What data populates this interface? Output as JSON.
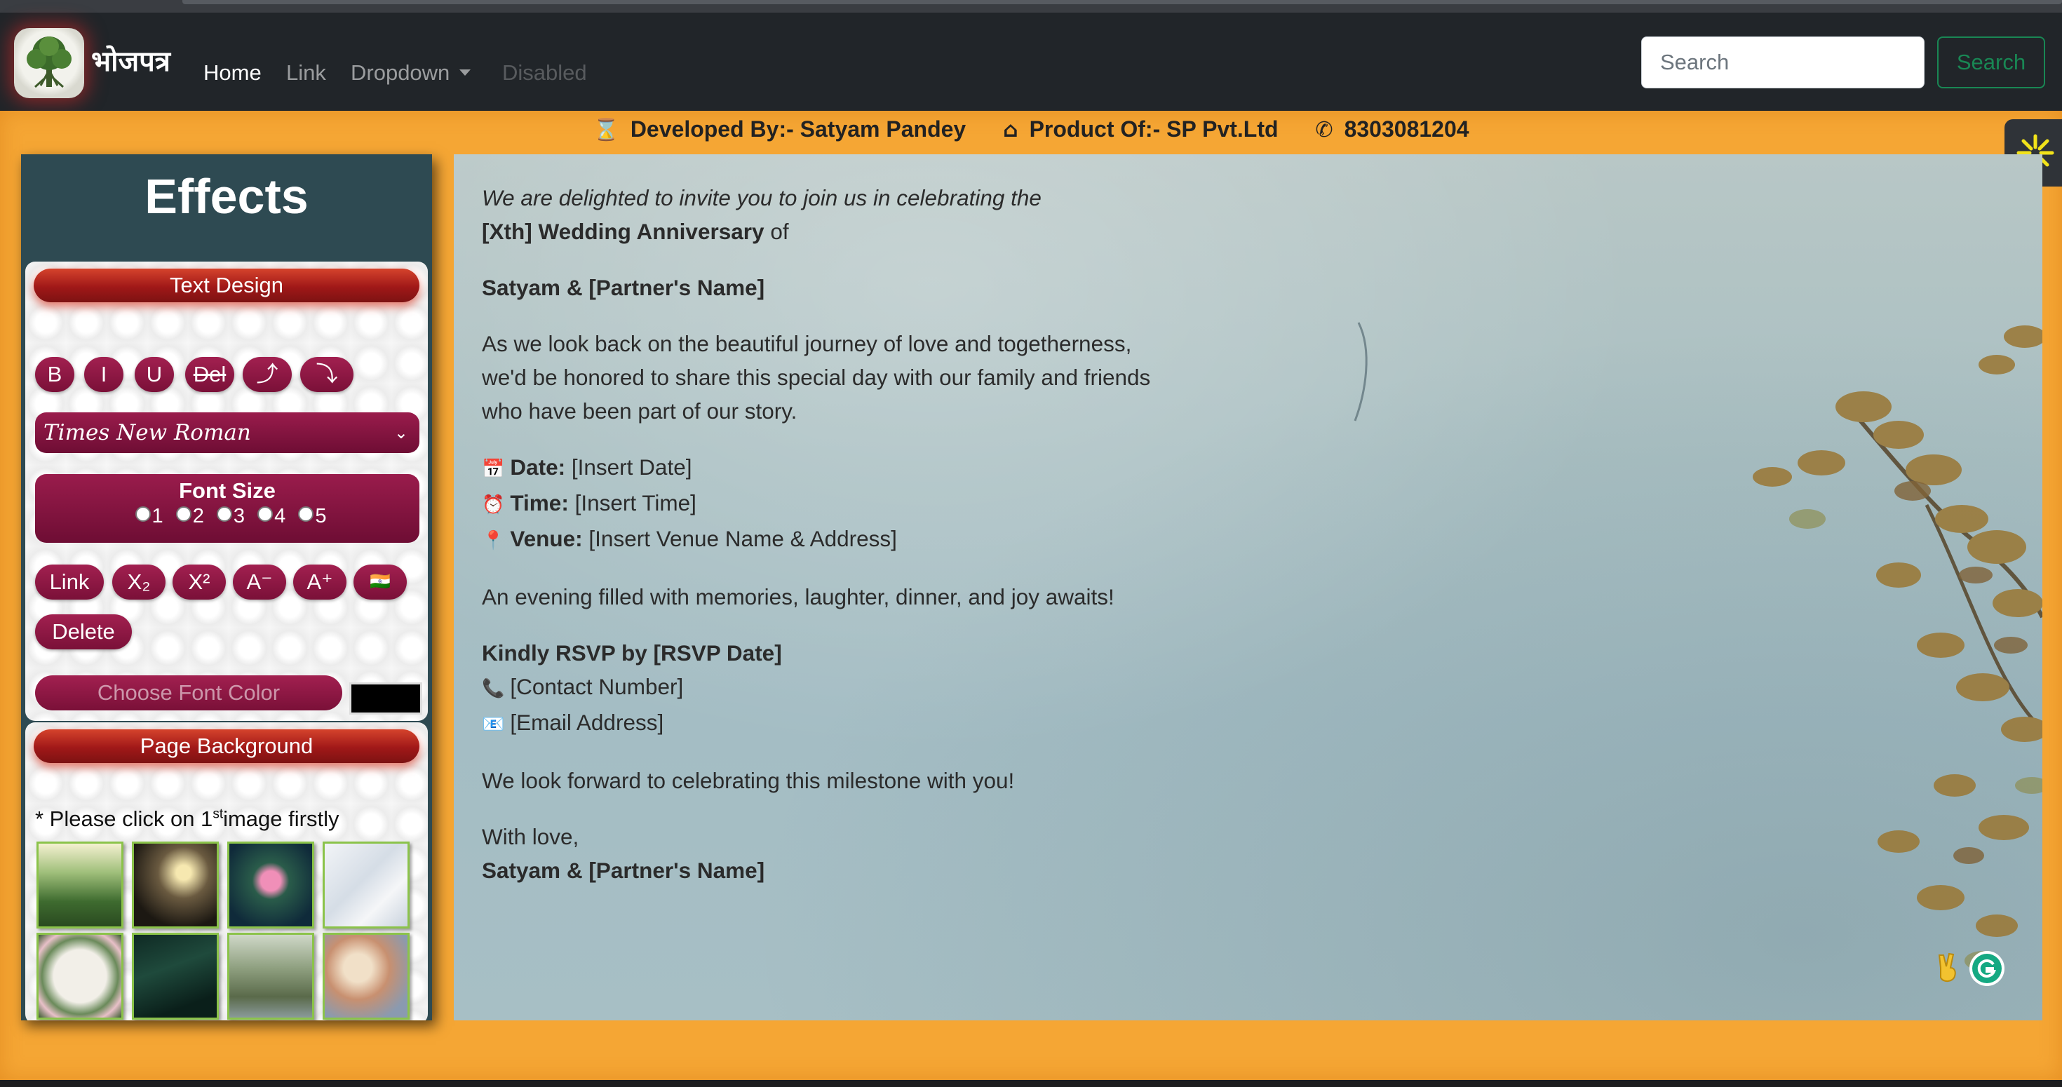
{
  "navbar": {
    "brand": "भोजपत्र",
    "links": [
      {
        "label": "Home",
        "state": "active"
      },
      {
        "label": "Link",
        "state": "normal"
      },
      {
        "label": "Dropdown",
        "state": "dropdown"
      },
      {
        "label": "Disabled",
        "state": "disabled"
      }
    ],
    "search_placeholder": "Search",
    "search_button": "Search"
  },
  "credits": {
    "developer": "Developed By:- Satyam Pandey",
    "product": "Product Of:- SP Pvt.Ltd",
    "phone": "8303081204",
    "developer_icon": "⌛",
    "product_icon": "⌂",
    "phone_icon": "✆"
  },
  "effects": {
    "title": "Effects",
    "text_design": {
      "header": "Text Design",
      "format_buttons": [
        "B",
        "I",
        "U",
        "Del",
        "⤴",
        "⤵"
      ],
      "font_family": "Times New Roman",
      "font_size_label": "Font Size",
      "font_size_options": [
        "1",
        "2",
        "3",
        "4",
        "5"
      ],
      "extra_buttons": [
        "Link",
        "X₂",
        "X²",
        "A⁻",
        "A⁺",
        "🇮🇳"
      ],
      "delete_button": "Delete",
      "color_label": "Choose Font Color"
    },
    "page_background": {
      "header": "Page Background",
      "note_prefix": "* Please click on 1",
      "note_sup": "st",
      "note_suffix": "image firstly",
      "thumbnails": [
        "mountain-valley",
        "couple-silhouette",
        "lotus-pond",
        "marble-white",
        "flower-frame",
        "dark-leaves",
        "landscape-painting",
        "cloud-fresco"
      ]
    }
  },
  "invitation": {
    "line1": "We are delighted to invite you to join us in celebrating the",
    "line2_bold": "[Xth] Wedding Anniversary",
    "line2_rest": " of",
    "couple": "Satyam & [Partner's Name]",
    "para1": [
      "As we look back on the beautiful journey of love and togetherness,",
      "we'd be honored to share this special day with our family and friends",
      "who have been part of our story."
    ],
    "details": [
      {
        "icon": "📅",
        "label": "Date:",
        "value": " [Insert Date]"
      },
      {
        "icon": "⏰",
        "label": "Time:",
        "value": " [Insert Time]"
      },
      {
        "icon": "📍",
        "label": "Venue:",
        "value": " [Insert Venue Name & Address]"
      }
    ],
    "evening": "An evening filled with memories, laughter, dinner, and joy awaits!",
    "rsvp": "Kindly RSVP by [RSVP Date]",
    "contact": [
      {
        "icon": "📞",
        "value": "[Contact Number]"
      },
      {
        "icon": "📧",
        "value": "[Email Address]"
      }
    ],
    "closing": "We look forward to celebrating this milestone with you!",
    "signoff": "With love,",
    "signature": "Satyam & [Partner's Name]"
  },
  "colors": {
    "navbar": "#212529",
    "orange": "#f5a634",
    "panel": "#2e4a52",
    "pill": "#8c1642",
    "card_header": "#b0261c",
    "search_green": "#198754"
  }
}
